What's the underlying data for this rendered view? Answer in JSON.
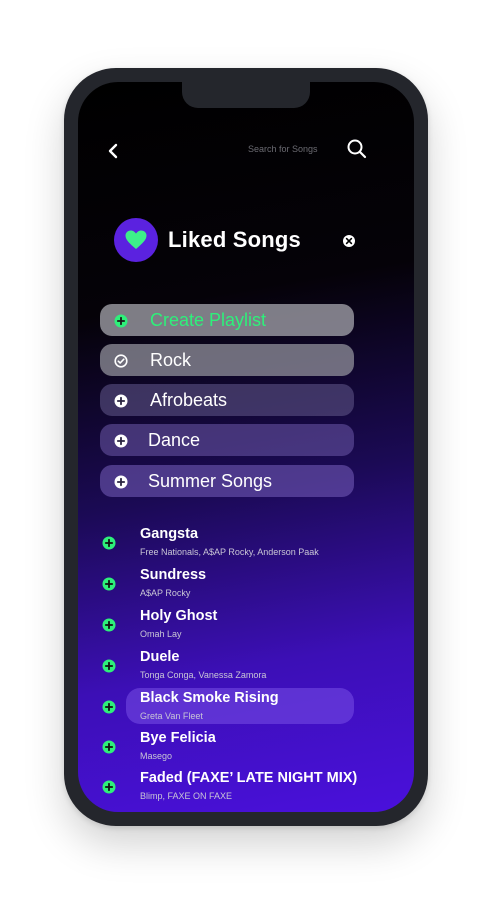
{
  "header": {
    "search_placeholder": "Search for Songs"
  },
  "liked": {
    "title": "Liked Songs"
  },
  "playlists": [
    {
      "label": "Create Playlist",
      "icon": "plus-circle-icon"
    },
    {
      "label": "Rock",
      "icon": "check-circle-icon"
    },
    {
      "label": "Afrobeats",
      "icon": "plus-circle-icon"
    },
    {
      "label": "Dance",
      "icon": "plus-circle-icon"
    },
    {
      "label": "Summer Songs",
      "icon": "plus-circle-icon"
    }
  ],
  "songs": [
    {
      "title": "Gangsta",
      "artist": "Free Nationals, A$AP Rocky, Anderson Paak"
    },
    {
      "title": "Sundress",
      "artist": "A$AP Rocky"
    },
    {
      "title": "Holy Ghost",
      "artist": "Omah Lay"
    },
    {
      "title": "Duele",
      "artist": "Tonga Conga, Vanessa Zamora"
    },
    {
      "title": "Black Smoke Rising",
      "artist": "Greta Van Fleet"
    },
    {
      "title": "Bye Felicia",
      "artist": "Masego"
    },
    {
      "title": "Faded (FAXE’ LATE NIGHT MIX)",
      "artist": "Blimp, FAXE ON FAXE"
    }
  ],
  "colors": {
    "accent_green": "#2ef07a",
    "heart_green": "#3df08a",
    "purple": "#5b22e0"
  }
}
